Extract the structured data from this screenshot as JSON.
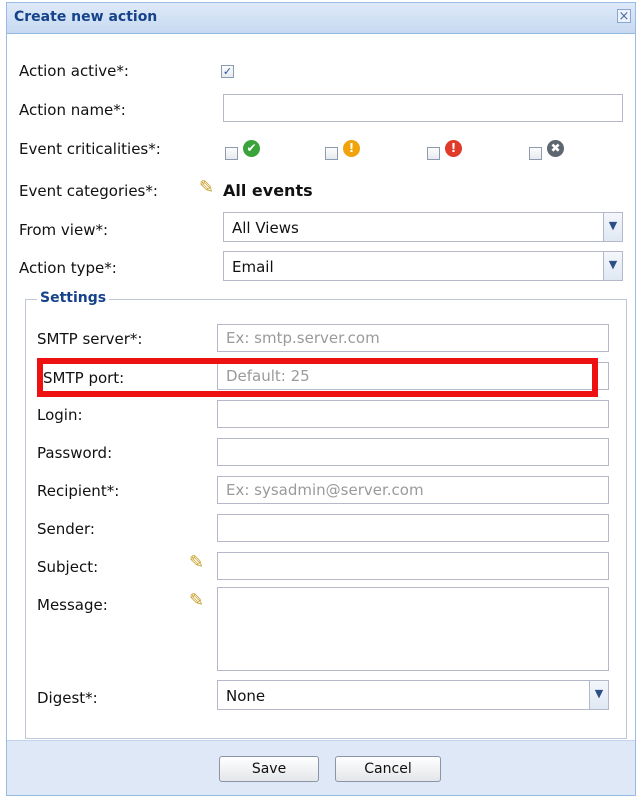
{
  "window": {
    "title": "Create new action",
    "close_glyph": "×"
  },
  "form": {
    "action_active": {
      "label": "Action active*:",
      "checked": true
    },
    "action_name": {
      "label": "Action name*:",
      "value": ""
    },
    "event_criticalities": {
      "label": "Event criticalities*:",
      "options": [
        {
          "icon": "ok-icon",
          "glyph": "✔",
          "color": "#3aa33a",
          "checked": false
        },
        {
          "icon": "warning-icon",
          "glyph": "!",
          "color": "#f0a30a",
          "checked": false
        },
        {
          "icon": "error-icon",
          "glyph": "!",
          "color": "#e03a2b",
          "checked": false
        },
        {
          "icon": "disabled-icon",
          "glyph": "✖",
          "color": "#5e6670",
          "checked": false
        }
      ]
    },
    "event_categories": {
      "label": "Event categories*:",
      "value": "All events"
    },
    "from_view": {
      "label": "From view*:",
      "value": "All Views"
    },
    "action_type": {
      "label": "Action type*:",
      "value": "Email"
    }
  },
  "settings": {
    "legend": "Settings",
    "smtp_server": {
      "label": "SMTP server*:",
      "placeholder": "Ex: smtp.server.com"
    },
    "smtp_port": {
      "label": "SMTP port:",
      "placeholder": "Default: 25"
    },
    "login": {
      "label": "Login:",
      "value": ""
    },
    "password": {
      "label": "Password:",
      "value": ""
    },
    "recipient": {
      "label": "Recipient*:",
      "placeholder": "Ex: sysadmin@server.com"
    },
    "sender": {
      "label": "Sender:",
      "value": ""
    },
    "subject": {
      "label": "Subject:",
      "value": ""
    },
    "message": {
      "label": "Message:",
      "value": ""
    },
    "digest": {
      "label": "Digest*:",
      "value": "None"
    }
  },
  "buttons": {
    "save": "Save",
    "cancel": "Cancel"
  },
  "colors": {
    "highlight": "#ee1111",
    "title_text": "#15428b",
    "footer_bg": "#dfe8f6"
  }
}
